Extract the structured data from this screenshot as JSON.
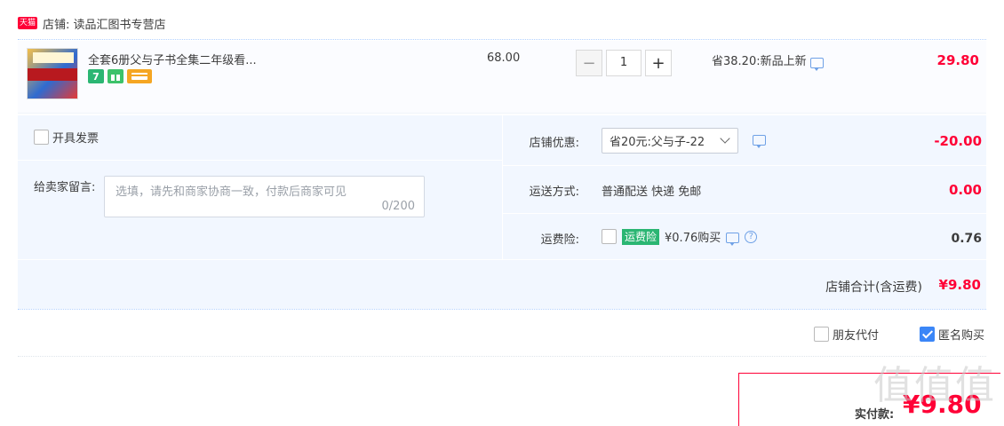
{
  "store": {
    "badge": "天猫",
    "label": "店铺: 读品汇图书专营店"
  },
  "item": {
    "title": "全套6册父与子书全集二年级看...",
    "icons": [
      "seven-day-return-icon",
      "gift-icon",
      "card-icon"
    ],
    "icon_seven": "7",
    "price": "68.00",
    "quantity": "1",
    "qty_minus": "−",
    "qty_plus": "+",
    "discount": "省38.20:新品上新",
    "subtotal": "29.80"
  },
  "invoice": {
    "label": "开具发票",
    "checked": false
  },
  "message": {
    "label": "给卖家留言:",
    "placeholder": "选填，请先和商家协商一致，付款后商家可见",
    "count": "0/200"
  },
  "coupon": {
    "label": "店铺优惠:",
    "selected": "省20元:父与子-22",
    "value": "-20.00"
  },
  "shipping": {
    "label": "运送方式:",
    "text": "普通配送 快递 免邮",
    "value": "0.00"
  },
  "insurance": {
    "label": "运费险:",
    "tag": "运费险",
    "text": "¥0.76购买",
    "help": "?",
    "value": "0.76",
    "checked": false
  },
  "store_total": {
    "label": "店铺合计(含运费)",
    "value": "¥9.80"
  },
  "options": {
    "friend_pay": "朋友代付",
    "friend_checked": false,
    "anonymous": "匿名购买",
    "anonymous_checked": true
  },
  "payment": {
    "label": "实付款:",
    "value": "¥9.80"
  },
  "watermark": "值值值",
  "colors": {
    "accent_red": "#ff0036",
    "panel_blue": "#f2f7ff",
    "check_blue": "#3b86f7",
    "tag_green": "#2bb673"
  }
}
